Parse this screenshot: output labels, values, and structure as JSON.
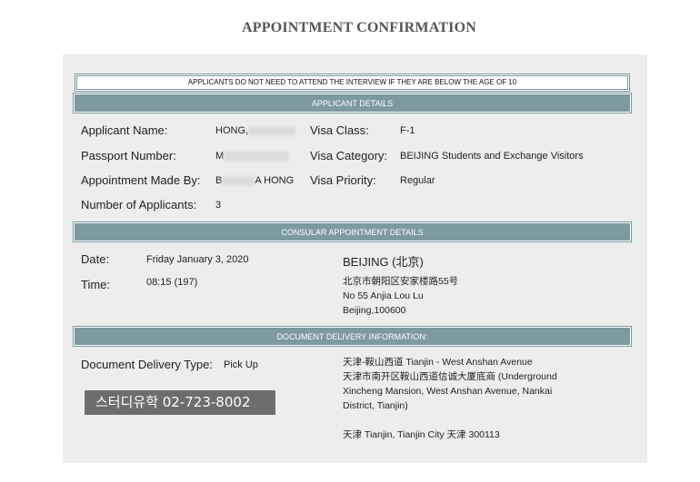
{
  "page_title": "APPOINTMENT CONFIRMATION",
  "notice": "APPLICANTS DO NOT NEED TO ATTEND THE INTERVIEW IF THEY ARE BELOW THE AGE OF 10",
  "applicant_details": {
    "header": "APPLICANT DETAILS",
    "applicant_name_label": "Applicant Name:",
    "applicant_name_value": "HONG,",
    "passport_number_label": "Passport Number:",
    "passport_number_value": "M",
    "appointment_made_by_label": "Appointment Made By:",
    "appointment_made_by_prefix": "B",
    "appointment_made_by_suffix": "A HONG",
    "number_of_applicants_label": "Number of Applicants:",
    "number_of_applicants_value": "3",
    "visa_class_label": "Visa Class:",
    "visa_class_value": "F-1",
    "visa_category_label": "Visa Category:",
    "visa_category_value": "BEIJING Students and Exchange Visitors",
    "visa_priority_label": "Visa Priority:",
    "visa_priority_value": "Regular"
  },
  "consular_details": {
    "header": "CONSULAR APPOINTMENT DETAILS",
    "date_label": "Date:",
    "date_value": "Friday January 3, 2020",
    "time_label": "Time:",
    "time_value": "08:15 (197)",
    "location_title": "BEIJING (北京)",
    "address_line1": "北京市朝阳区安家楼路55号",
    "address_line2": "No 55 Anjia Lou Lu",
    "address_line3": "Beijing,100600"
  },
  "delivery": {
    "header": "DOCUMENT DELIVERY INFORMATION:",
    "type_label": "Document Delivery Type:",
    "type_value": "Pick Up",
    "address_line1": "天津-鞍山西道 Tianjin - West Anshan Avenue",
    "address_line2": "天津市南开区鞍山西道信诚大厦底商 (Underground",
    "address_line3": "Xincheng Mansion, West Anshan Avenue, Nankai",
    "address_line4": "District, Tianjin)",
    "address_line5": "天津 Tianjin, Tianjin City 天津 300113"
  },
  "watermark": "스터디유학  02-723-8002",
  "colors": {
    "header_bar": "#7c9aa0",
    "panel_bg": "#ededed",
    "watermark_bg": "#6d6d6d"
  }
}
